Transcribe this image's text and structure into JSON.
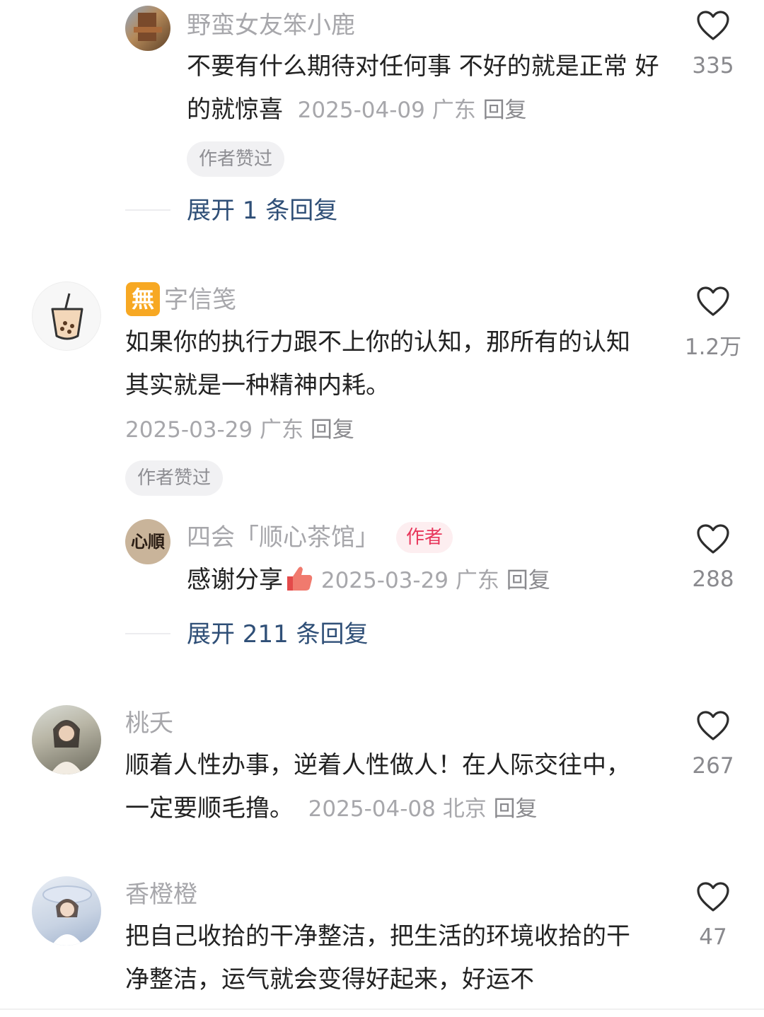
{
  "comments": [
    {
      "name": "野蛮女友笨小鹿",
      "text": "不要有什么期待对任何事 不好的就是正常 好的就惊喜",
      "date": "2025-04-09",
      "location": "广东",
      "reply": "回复",
      "badge": "作者赞过",
      "likes": "335",
      "expand": "展开 1 条回复"
    },
    {
      "name_icon": "無",
      "name": "字信笺",
      "text": "如果你的执行力跟不上你的认知，那所有的认知其实就是一种精神内耗。",
      "date": "2025-03-29",
      "location": "广东",
      "reply": "回复",
      "badge": "作者赞过",
      "likes": "1.2万",
      "subreply": {
        "avatar_text": "心順",
        "name": "四会「顺心茶馆」",
        "author_tag": "作者",
        "text": "感谢分享",
        "date": "2025-03-29",
        "location": "广东",
        "reply": "回复",
        "likes": "288"
      },
      "expand": "展开 211 条回复"
    },
    {
      "name": "桃夭",
      "text": "顺着人性办事，逆着人性做人！在人际交往中，一定要顺毛撸。",
      "date": "2025-04-08",
      "location": "北京",
      "reply": "回复",
      "likes": "267"
    },
    {
      "name": "香橙橙",
      "text": "把自己收拾的干净整洁，把生活的环境收拾的干净整洁，运气就会变得好起来，好运不",
      "likes": "47"
    }
  ],
  "colors": {
    "link": "#2f4f77",
    "meta": "#a7a7ab",
    "author_tag": "#e8375c"
  },
  "icons": {
    "like": "heart-outline-icon",
    "emoji": "thumbs-up-emoji-icon"
  }
}
